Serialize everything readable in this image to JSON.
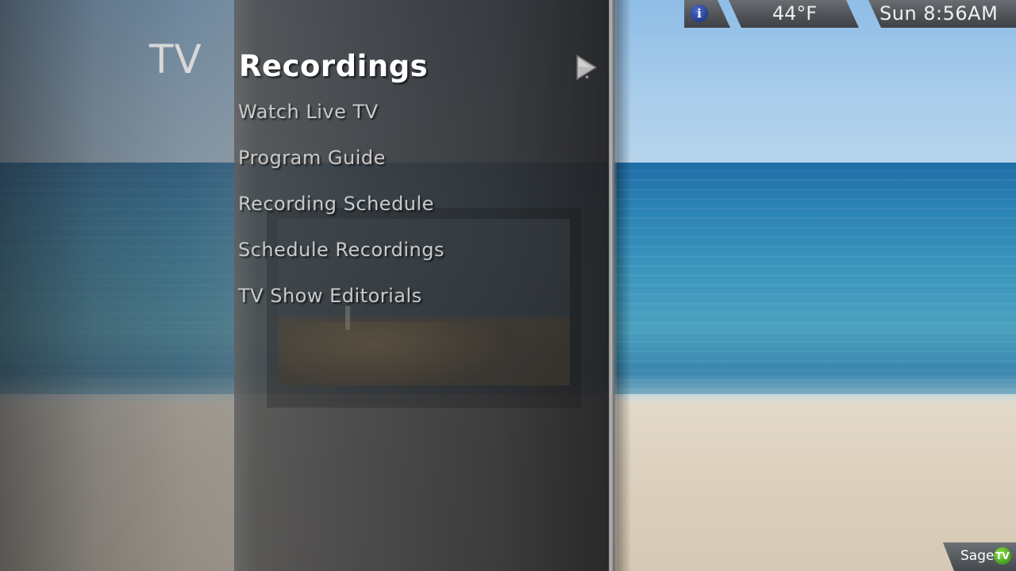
{
  "category": "TV",
  "menu": {
    "title": "Recordings",
    "items": [
      {
        "label": "Watch Live TV"
      },
      {
        "label": "Program Guide"
      },
      {
        "label": "Recording Schedule"
      },
      {
        "label": "Schedule Recordings"
      },
      {
        "label": "TV Show Editorials"
      }
    ],
    "title_arrow_icon": "play-arrow-icon"
  },
  "status_bar": {
    "info_icon": "info-icon",
    "info_glyph": "i",
    "temperature": "44°F",
    "time": "Sun  8:56AM"
  },
  "logo": {
    "text": "Sage",
    "badge": "TV"
  },
  "colors": {
    "info_icon": "#2d4aa8",
    "logo_badge": "#5cb82a",
    "menu_text": "#c9c9c9",
    "title_text": "#ffffff"
  }
}
